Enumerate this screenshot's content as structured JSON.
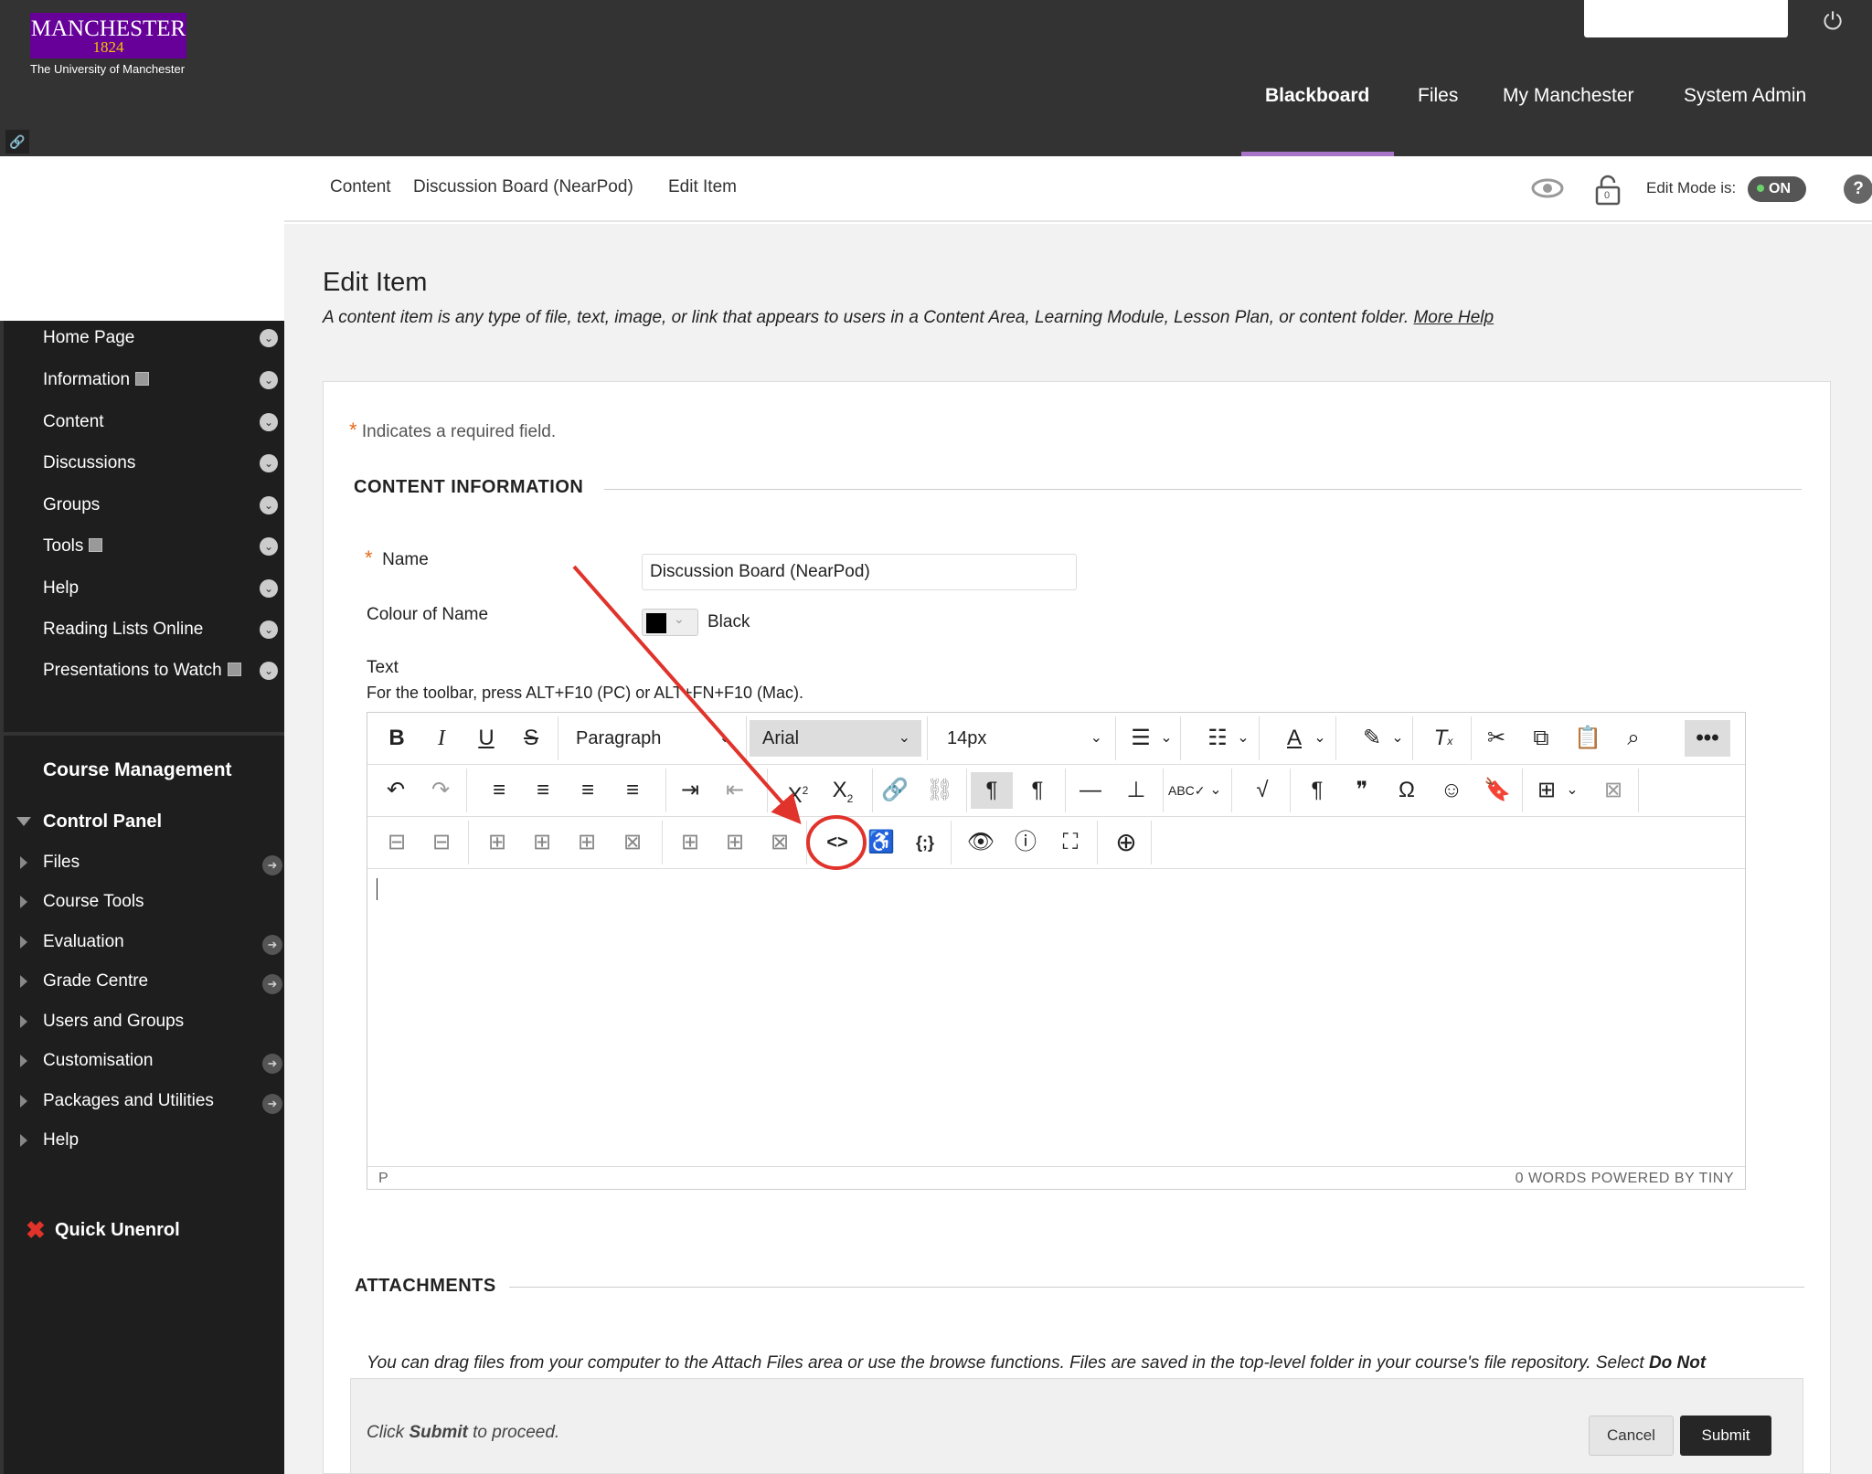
{
  "header": {
    "logo_text": "MANCHESTER",
    "logo_year": "1824",
    "logo_subtitle": "The University of Manchester",
    "nav": [
      "Blackboard",
      "Files",
      "My Manchester",
      "System Admin"
    ]
  },
  "breadcrumb": {
    "items": [
      "Content",
      "Discussion Board (NearPod)",
      "Edit Item"
    ],
    "edit_mode_label": "Edit Mode is:",
    "edit_mode_value": "ON",
    "lock_count": "0"
  },
  "course_menu": {
    "items": [
      "Home Page",
      "Information",
      "Content",
      "Discussions",
      "Groups",
      "Tools",
      "Help",
      "Reading Lists Online",
      "Presentations to Watch"
    ]
  },
  "course_management": {
    "title": "Course Management",
    "control_panel": "Control Panel",
    "items": [
      "Files",
      "Course Tools",
      "Evaluation",
      "Grade Centre",
      "Users and Groups",
      "Customisation",
      "Packages and Utilities",
      "Help"
    ],
    "quick_unenrol": "Quick Unenrol"
  },
  "page": {
    "title": "Edit Item",
    "description": "A content item is any type of file, text, image, or link that appears to users in a Content Area, Learning Module, Lesson Plan, or content folder.",
    "more_help": "More Help",
    "required_note": "Indicates a required field.",
    "section_content": "CONTENT INFORMATION",
    "name_label": "Name",
    "name_value": "Discussion Board (NearPod)",
    "colour_label": "Colour of Name",
    "colour_value": "Black",
    "text_label": "Text",
    "toolbar_hint": "For the toolbar, press ALT+F10 (PC) or ALT+FN+F10 (Mac).",
    "section_attachments": "ATTACHMENTS",
    "attach_desc": "You can drag files from your computer to the Attach Files area or use the browse functions. Files are saved in the top-level folder in your course's file repository.  Select",
    "attach_desc_bold": "Do Not"
  },
  "editor": {
    "block_format": "Paragraph",
    "font_family": "Arial",
    "font_size": "14px",
    "status_path": "P",
    "status_words": "0 WORDS  POWERED BY TINY"
  },
  "submit": {
    "hint_pre": "Click ",
    "hint_bold": "Submit",
    "hint_post": " to proceed.",
    "cancel": "Cancel",
    "submit": "Submit"
  },
  "colors": {
    "topbar": "#333333",
    "brand_purple": "#660099",
    "annotation_red": "#e0332b"
  }
}
